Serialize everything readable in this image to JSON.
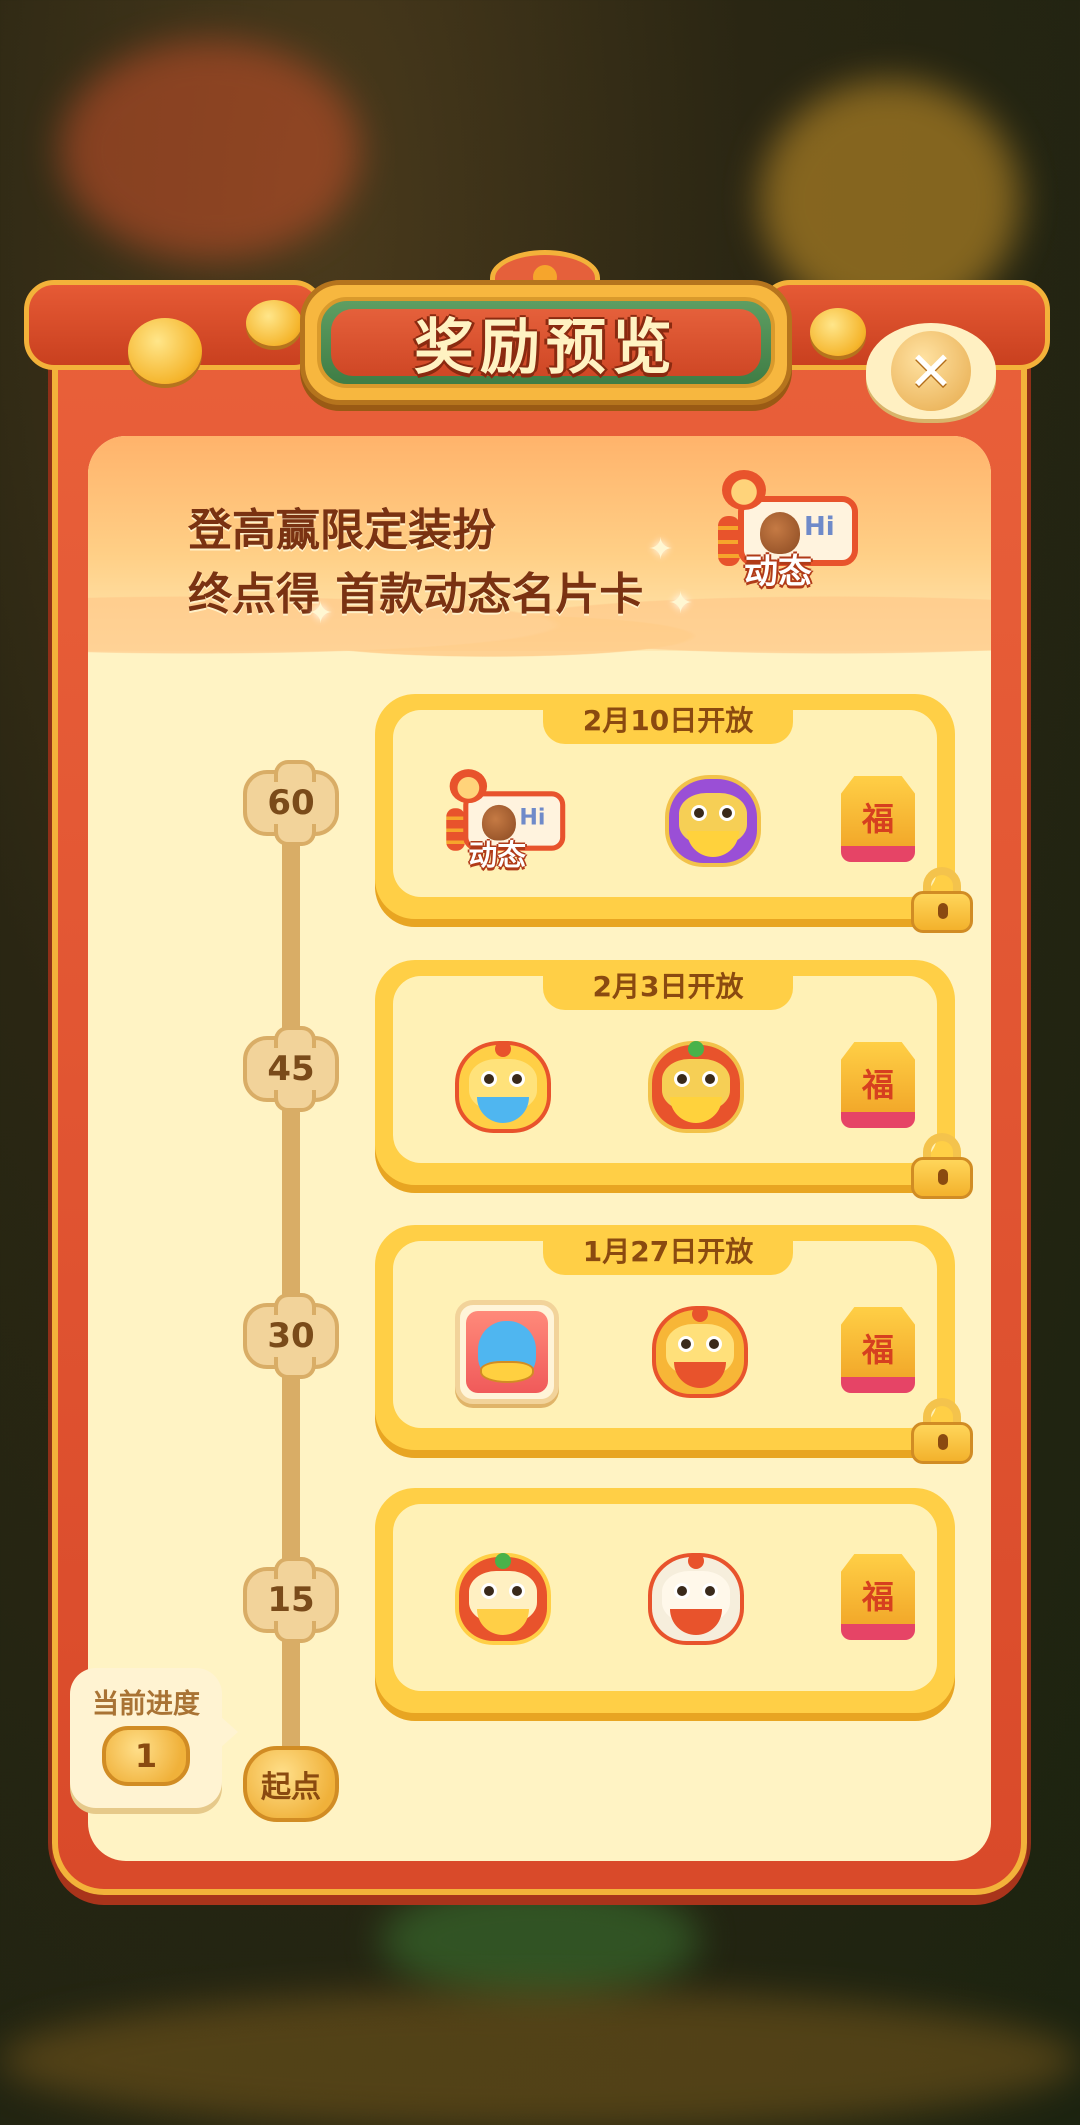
{
  "popup": {
    "title": "奖励预览",
    "close_icon": "close-icon"
  },
  "banner": {
    "line1": "登高赢限定装扮",
    "line2_prefix": "终点得",
    "line2_highlight": "首款动态名片卡",
    "card_hi": "Hi",
    "card_tag": "动态"
  },
  "timeline": {
    "start_label": "起点",
    "current_progress_label": "当前进度",
    "current_progress_value": "1",
    "tiers": [
      {
        "step": "60",
        "date": "2月10日开放",
        "locked": true,
        "items": [
          "dynamic-card-icon",
          "purple-lion-head-icon",
          "fu-badge-icon"
        ],
        "card_hi": "Hi",
        "card_tag": "动态",
        "fu_char": "福"
      },
      {
        "step": "45",
        "date": "2月3日开放",
        "locked": true,
        "items": [
          "lion-dance-avatar-icon",
          "red-lion-head-icon",
          "fu-badge-icon"
        ],
        "fu_char": "福"
      },
      {
        "step": "30",
        "date": "1月27日开放",
        "locked": true,
        "items": [
          "blue-pet-avatar-frame-icon",
          "yellow-lion-head-icon",
          "fu-badge-icon"
        ],
        "fu_char": "福"
      },
      {
        "step": "15",
        "date": "",
        "locked": false,
        "items": [
          "lion-dance-costume-icon",
          "white-lion-head-icon",
          "fu-badge-icon"
        ],
        "fu_char": "福"
      }
    ]
  },
  "colors": {
    "panel_red": "#d94a2a",
    "panel_gold": "#f3b23a",
    "card_yellow": "#ffcf46",
    "card_inner": "#fff1b6",
    "text_brown": "#7a3212"
  }
}
